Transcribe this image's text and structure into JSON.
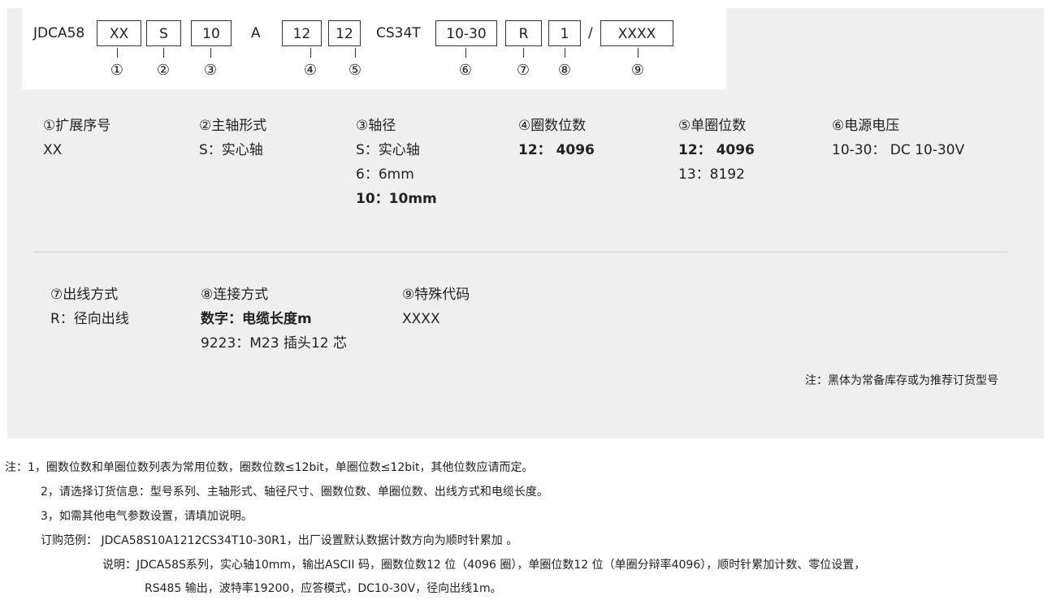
{
  "code": {
    "prefix": "JDCA58",
    "xx": "XX",
    "s": "S",
    "n10": "10",
    "a": "A",
    "n12a": "12",
    "n12b": "12",
    "cs": "CS34T",
    "volt": "10-30",
    "r": "R",
    "one": "1",
    "slash": "/",
    "xxxx": "XXXX",
    "markers": [
      "①",
      "②",
      "③",
      "④",
      "⑤",
      "⑥",
      "⑦",
      "⑧",
      "⑨"
    ]
  },
  "fields": {
    "f1": {
      "heading": "①扩展序号",
      "lines": [
        "XX"
      ]
    },
    "f2": {
      "heading": "②主轴形式",
      "lines": [
        "S：实心轴"
      ]
    },
    "f3": {
      "heading": "③轴径",
      "lines": [
        "S：实心轴",
        "6：6mm",
        "10：10mm"
      ]
    },
    "f4": {
      "heading": "④圈数位数",
      "lines": [
        "12：  4096"
      ]
    },
    "f5": {
      "heading": "⑤单圈位数",
      "lines": [
        "12：  4096",
        "13：8192"
      ]
    },
    "f6": {
      "heading": "⑥电源电压",
      "lines": [
        "10-30：  DC 10-30V"
      ]
    },
    "f7": {
      "heading": "⑦出线方式",
      "lines": [
        "R：径向出线"
      ]
    },
    "f8": {
      "heading": "⑧连接方式",
      "lines": [
        "数字：电缆长度m",
        "9223：M23 插头12 芯"
      ]
    },
    "f9": {
      "heading": "⑨特殊代码",
      "lines": [
        "XXXX"
      ]
    }
  },
  "panel_note": "注：黑体为常备库存或为推荐订货型号",
  "notes": {
    "n1": "注：1，圈数位数和单圈位数列表为常用位数，圈数位数≤12bit，单圈位数≤12bit，其他位数应请而定。",
    "n2": "2，请选择订货信息：型号系列、主轴形式、轴径尺寸、圈数位数、单圈位数、出线方式和电缆长度。",
    "n3": "3，如需其他电气参数设置，请填加说明。",
    "example": "订购范例：  JDCA58S10A1212CS34T10-30R1，出厂设置默认数据计数方向为顺时针累加 。",
    "explain1": "说明：JDCA58S系列，实心轴10mm，输出ASCII 码，圈数位数12 位（4096 圈），单圈位数12 位（单圈分辩率4096），顺时针累加计数、零位设置，",
    "explain2": "RS485 输出，波特率19200，应答模式，DC10-30V，径向出线1m。"
  }
}
